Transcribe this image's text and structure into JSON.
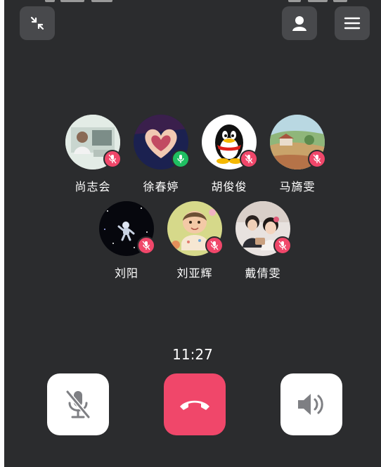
{
  "call": {
    "timer": "11:27",
    "participants_row1": [
      {
        "name": "尚志会",
        "mic": "muted",
        "avatar": "photo-person"
      },
      {
        "name": "徐春婷",
        "mic": "active",
        "avatar": "photo-hands-heart"
      },
      {
        "name": "胡俊俊",
        "mic": "muted",
        "avatar": "qq-penguin"
      },
      {
        "name": "马旖雯",
        "mic": "muted",
        "avatar": "landscape-painting"
      }
    ],
    "participants_row2": [
      {
        "name": "刘阳",
        "mic": "muted",
        "avatar": "space-astronaut"
      },
      {
        "name": "刘亚辉",
        "mic": "muted",
        "avatar": "cartoon-baby"
      },
      {
        "name": "戴倩雯",
        "mic": "muted",
        "avatar": "photo-family"
      }
    ]
  },
  "colors": {
    "background": "#2b2c2e",
    "muted_badge": "#f0476a",
    "active_badge": "#1fbf62",
    "hangup": "#f0476a"
  },
  "icons": {
    "minimize": "minimize-icon",
    "contacts": "contact-icon",
    "menu": "menu-icon",
    "mute": "mic-off-icon",
    "hangup": "phone-hangup-icon",
    "speaker": "speaker-icon"
  }
}
